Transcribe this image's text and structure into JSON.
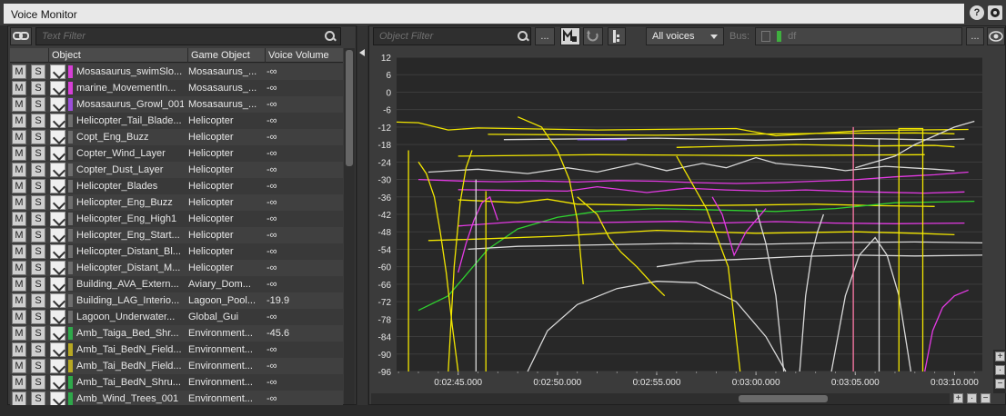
{
  "window": {
    "title": "Voice Monitor"
  },
  "left": {
    "text_filter_placeholder": "Text Filter",
    "columns": {
      "object": "Object",
      "game_object": "Game Object",
      "voice_volume": "Voice Volume"
    },
    "mute_label": "M",
    "solo_label": "S",
    "rows": [
      {
        "object": "Mosasaurus_swimSlo...",
        "game_object": "Mosasaurus_...",
        "volume": "-∞",
        "color": "#d63fd6"
      },
      {
        "object": "marine_MovementIn...",
        "game_object": "Mosasaurus_...",
        "volume": "-∞",
        "color": "#d63fd6"
      },
      {
        "object": "Mosasaurus_Growl_001",
        "game_object": "Mosasaurus_...",
        "volume": "-∞",
        "color": "#9b4fd9"
      },
      {
        "object": "Helicopter_Tail_Blade...",
        "game_object": "Helicopter",
        "volume": "-∞",
        "color": "#6e6e6e"
      },
      {
        "object": "Copt_Eng_Buzz",
        "game_object": "Helicopter",
        "volume": "-∞",
        "color": "#6e6e6e"
      },
      {
        "object": "Copter_Wind_Layer",
        "game_object": "Helicopter",
        "volume": "-∞",
        "color": "#6e6e6e"
      },
      {
        "object": "Copter_Dust_Layer",
        "game_object": "Helicopter",
        "volume": "-∞",
        "color": "#6e6e6e"
      },
      {
        "object": "Helicopter_Blades",
        "game_object": "Helicopter",
        "volume": "-∞",
        "color": "#6e6e6e"
      },
      {
        "object": "Helicopter_Eng_Buzz",
        "game_object": "Helicopter",
        "volume": "-∞",
        "color": "#6e6e6e"
      },
      {
        "object": "Helicopter_Eng_High1",
        "game_object": "Helicopter",
        "volume": "-∞",
        "color": "#6e6e6e"
      },
      {
        "object": "Helicopter_Eng_Start...",
        "game_object": "Helicopter",
        "volume": "-∞",
        "color": "#6e6e6e"
      },
      {
        "object": "Helicopter_Distant_Bl...",
        "game_object": "Helicopter",
        "volume": "-∞",
        "color": "#6e6e6e"
      },
      {
        "object": "Helicopter_Distant_M...",
        "game_object": "Helicopter",
        "volume": "-∞",
        "color": "#6e6e6e"
      },
      {
        "object": "Building_AVA_Extern...",
        "game_object": "Aviary_Dom...",
        "volume": "-∞",
        "color": "#6e6e6e"
      },
      {
        "object": "Building_LAG_Interio...",
        "game_object": "Lagoon_Pool...",
        "volume": "-19.9",
        "color": "#6e6e6e"
      },
      {
        "object": "Lagoon_Underwater...",
        "game_object": "Global_Gui",
        "volume": "-∞",
        "color": "#6e6e6e"
      },
      {
        "object": "Amb_Taiga_Bed_Shr...",
        "game_object": "Environment...",
        "volume": "-45.6",
        "color": "#2ea84a"
      },
      {
        "object": "Amb_Tai_BedN_Field...",
        "game_object": "Environment...",
        "volume": "-∞",
        "color": "#b7a823"
      },
      {
        "object": "Amb_Tai_BedN_Field...",
        "game_object": "Environment...",
        "volume": "-∞",
        "color": "#b7a823"
      },
      {
        "object": "Amb_Tai_BedN_Shru...",
        "game_object": "Environment...",
        "volume": "-∞",
        "color": "#2ea84a"
      },
      {
        "object": "Amb_Wind_Trees_001",
        "game_object": "Environment...",
        "volume": "-∞",
        "color": "#2ea84a"
      }
    ]
  },
  "right": {
    "object_filter_placeholder": "Object Filter",
    "more_button": "...",
    "voices_dropdown": "All voices",
    "bus_label": "Bus:",
    "bus_value": "df",
    "overflow_button": "...",
    "icons": [
      "search-icon",
      "voice-graph-icon",
      "loop-icon",
      "marker-icon",
      "eye-icon",
      "link-icon"
    ]
  },
  "chart_data": {
    "type": "line",
    "y_ticks": [
      "12",
      "6",
      "0",
      "-6",
      "-12",
      "-18",
      "-24",
      "-30",
      "-36",
      "-42",
      "-48",
      "-54",
      "-60",
      "-66",
      "-72",
      "-78",
      "-84",
      "-90",
      "-96"
    ],
    "ylim": [
      -96,
      12
    ],
    "x_ticks": [
      "0:02:45.000",
      "0:02:50.000",
      "0:02:55.000",
      "0:03:00.000",
      "0:03:05.000",
      "0:03:10.000"
    ],
    "xlim": [
      161.9,
      191.4
    ],
    "grid": true,
    "colors": {
      "background": "#282828",
      "yellow": "#f2e600",
      "magenta": "#e43ae4",
      "green": "#2fd12f",
      "white": "#d8d8d8",
      "pink": "#ff7aa8",
      "violet": "#9a6cff"
    },
    "series": [
      {
        "color": "yellow",
        "x": [
          161.9,
          163.0,
          164.5,
          166.0,
          172.0,
          179.0,
          181.0,
          185.5,
          190.7
        ],
        "y": [
          -10.3,
          -10.5,
          -13.0,
          -12.3,
          -13.0,
          -12.5,
          -15.0,
          -13.2,
          -12.8
        ]
      },
      {
        "color": "yellow",
        "x": [
          166.5,
          175.0,
          183.0,
          188.0,
          190.0
        ],
        "y": [
          -14.5,
          -14.8,
          -14.2,
          -14.0,
          -14.3
        ]
      },
      {
        "color": "white",
        "x": [
          167.3,
          175.0,
          180.0,
          185.0,
          189.0,
          190.5
        ],
        "y": [
          -16.3,
          -15.8,
          -16.5,
          -15.9,
          -16.4,
          -16.1
        ]
      },
      {
        "color": "violet",
        "x": [
          171.0,
          173.5
        ],
        "y": [
          -16.3,
          -16.3
        ]
      },
      {
        "color": "yellow",
        "x": [
          176.0,
          182.0,
          186.0,
          189.0,
          190.0
        ],
        "y": [
          -19.0,
          -18.0,
          -18.5,
          -18.3,
          -18.8
        ]
      },
      {
        "color": "yellow",
        "x": [
          165.0,
          172.0,
          180.0,
          188.5
        ],
        "y": [
          -22.0,
          -21.5,
          -21.8,
          -21.5
        ]
      },
      {
        "color": "white",
        "x": [
          163.5,
          166.0,
          168.5,
          170.5,
          172.0,
          174.0,
          175.5,
          177.3,
          178.5,
          180.0,
          181.0,
          183.5,
          184.5,
          186.5,
          189.0,
          190.0
        ],
        "y": [
          -27.5,
          -26.5,
          -28.0,
          -26.0,
          -27.5,
          -24.5,
          -27.0,
          -24.5,
          -26.0,
          -22.5,
          -24.5,
          -26.0,
          -27.0,
          -25.5,
          -26.5,
          -27.0
        ]
      },
      {
        "color": "magenta",
        "x": [
          163.0,
          165.0,
          167.0,
          169.0,
          171.0,
          173.0,
          175.0,
          177.0,
          179.0,
          181.0,
          183.0,
          185.0,
          187.0,
          189.0,
          190.7
        ],
        "y": [
          -30.0,
          -30.5,
          -30.8,
          -30.5,
          -30.9,
          -30.4,
          -30.6,
          -31.1,
          -31.4,
          -31.1,
          -30.6,
          -30.1,
          -29.1,
          -28.4,
          -27.5
        ]
      },
      {
        "color": "magenta",
        "x": [
          165.0,
          168.0,
          170.5,
          172.0,
          174.5,
          176.5,
          178.5,
          180.5,
          182.5,
          184.5,
          186.5,
          188.5,
          190.5
        ],
        "y": [
          -33.5,
          -33.8,
          -34.0,
          -32.5,
          -34.5,
          -33.0,
          -33.6,
          -34.0,
          -33.6,
          -34.1,
          -34.4,
          -34.7,
          -34.3
        ]
      },
      {
        "color": "yellow",
        "x": [
          165.0,
          168.0,
          169.5,
          171.0,
          174.0,
          177.0,
          180.0,
          183.0,
          186.0,
          189.0
        ],
        "y": [
          -37.0,
          -38.0,
          -36.8,
          -38.5,
          -38.8,
          -39.0,
          -38.8,
          -38.5,
          -39.0,
          -39.3
        ]
      },
      {
        "color": "green",
        "x": [
          163.0,
          164.5,
          165.5,
          166.5,
          168.0,
          170.0,
          172.0,
          175.0,
          178.0,
          181.0,
          184.0,
          187.0,
          191.0
        ],
        "y": [
          -75.0,
          -70.0,
          -62.0,
          -54.0,
          -47.0,
          -43.0,
          -41.0,
          -40.0,
          -40.5,
          -41.0,
          -40.0,
          -38.0,
          -37.5
        ]
      },
      {
        "color": "magenta",
        "x": [
          165.0,
          168.0,
          172.0,
          176.0,
          178.0,
          181.0,
          184.0,
          187.0,
          190.5
        ],
        "y": [
          -46.0,
          -44.5,
          -44.8,
          -44.4,
          -45.0,
          -44.5,
          -45.0,
          -45.2,
          -45.0
        ]
      },
      {
        "color": "yellow",
        "x": [
          163.5,
          166.0,
          170.0,
          175.0,
          180.0,
          185.0,
          188.0,
          190.0
        ],
        "y": [
          -51.0,
          -50.5,
          -49.5,
          -47.5,
          -48.5,
          -48.0,
          -48.5,
          -49.0
        ]
      },
      {
        "color": "white",
        "x": [
          165.5,
          168.0,
          172.0,
          176.0,
          180.0,
          184.0,
          188.0,
          191.4
        ],
        "y": [
          -54.0,
          -53.0,
          -52.5,
          -52.0,
          -52.3,
          -51.7,
          -51.5,
          -51.8
        ]
      },
      {
        "color": "white",
        "x": [
          175.0,
          177.0,
          179.0,
          182.0,
          185.0,
          188.0,
          191.4
        ],
        "y": [
          -60.0,
          -58.0,
          -57.5,
          -56.5,
          -56.0,
          -56.3,
          -56.0
        ]
      },
      {
        "color": "white",
        "x": [
          168.5,
          169.5,
          171.0,
          173.0,
          175.0,
          177.0,
          179.0,
          180.5,
          181.5
        ],
        "y": [
          -96.0,
          -82.0,
          -73.0,
          -67.5,
          -65.0,
          -65.5,
          -72.0,
          -84.0,
          -96.0
        ]
      },
      {
        "color": "white",
        "x": [
          183.8,
          184.5,
          185.2,
          186.0,
          186.6,
          187.2,
          187.8
        ],
        "y": [
          -96.0,
          -70.0,
          -56.0,
          -50.0,
          -56.0,
          -70.0,
          -96.0
        ]
      },
      {
        "color": "white",
        "x": [
          185.0,
          186.0,
          187.0,
          188.0,
          189.0,
          190.0,
          191.0
        ],
        "y": [
          -26.0,
          -24.0,
          -22.0,
          -18.0,
          -15.0,
          -12.0,
          -10.0
        ]
      },
      {
        "color": "yellow",
        "x": [
          171.0,
          172.0,
          172.6,
          173.2,
          174.0,
          174.8,
          175.4
        ],
        "y": [
          -36.0,
          -42.0,
          -50.0,
          -55.0,
          -60.0,
          -66.0,
          -70.0
        ]
      },
      {
        "color": "yellow",
        "x": [
          168.0,
          169.2,
          170.0,
          170.6,
          171.0,
          171.3
        ],
        "y": [
          -8.5,
          -12.0,
          -20.0,
          -30.0,
          -44.0,
          -66.0
        ]
      },
      {
        "color": "yellow",
        "x": [
          176.0,
          177.5,
          178.6,
          179.2
        ],
        "y": [
          -22.0,
          -40.0,
          -60.0,
          -96.0
        ]
      },
      {
        "color": "yellow",
        "x": [
          163.0,
          163.4,
          163.8,
          164.1,
          164.4,
          164.7,
          165.0
        ],
        "y": [
          -24.0,
          -28.0,
          -36.0,
          -48.0,
          -62.0,
          -80.0,
          -96.0
        ]
      },
      {
        "color": "yellow",
        "x": [
          164.5,
          164.8,
          165.1,
          165.4,
          165.7
        ],
        "y": [
          -96.0,
          -60.0,
          -38.0,
          -26.0,
          -20.0
        ]
      },
      {
        "color": "magenta",
        "x": [
          165.0,
          165.4,
          165.8,
          166.2,
          166.6,
          167.0
        ],
        "y": [
          -62.0,
          -52.0,
          -44.0,
          -38.0,
          -36.0,
          -44.0
        ]
      },
      {
        "color": "magenta",
        "x": [
          177.8,
          178.3,
          178.9,
          179.5,
          180.5
        ],
        "y": [
          -36.0,
          -42.0,
          -56.0,
          -48.0,
          -40.0
        ]
      },
      {
        "color": "magenta",
        "x": [
          188.5,
          188.9,
          189.4,
          190.0,
          190.7
        ],
        "y": [
          -96.0,
          -82.0,
          -74.0,
          -70.0,
          -68.0
        ]
      },
      {
        "color": "white",
        "x": [
          180.0,
          180.5,
          181.0,
          181.4
        ],
        "y": [
          -40.0,
          -52.0,
          -70.0,
          -96.0
        ]
      },
      {
        "color": "white",
        "x": [
          182.2,
          182.5,
          182.8,
          183.1,
          183.4
        ],
        "y": [
          -96.0,
          -70.0,
          -56.0,
          -48.0,
          -42.0
        ]
      },
      {
        "color": "pink",
        "x": [
          184.9,
          184.9
        ],
        "y": [
          -12.0,
          -96.0
        ]
      },
      {
        "color": "yellow",
        "x": [
          187.2,
          187.2,
          188.4,
          188.4
        ],
        "y": [
          -96.0,
          -12.5,
          -12.5,
          -96.0
        ]
      },
      {
        "color": "yellow",
        "x": [
          162.5,
          162.5
        ],
        "y": [
          -20.0,
          -96.0
        ]
      },
      {
        "color": "white",
        "x": [
          186.2,
          186.2
        ],
        "y": [
          -16.0,
          -96.0
        ]
      },
      {
        "color": "yellow",
        "x": [
          166.4,
          166.4
        ],
        "y": [
          -34.0,
          -96.0
        ]
      },
      {
        "color": "white",
        "x": [
          165.9,
          165.9
        ],
        "y": [
          -30.0,
          -96.0
        ]
      }
    ]
  }
}
